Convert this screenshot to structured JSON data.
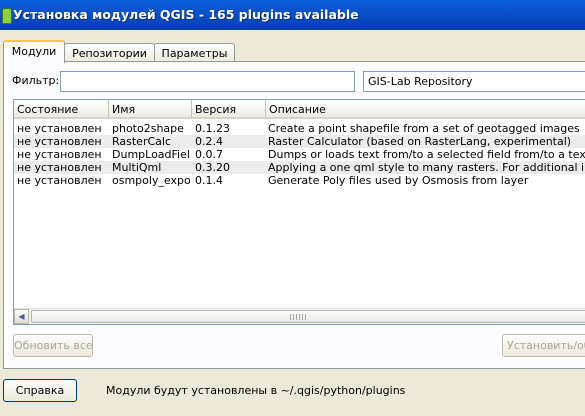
{
  "window": {
    "title": "Установка модулей QGIS - 165 plugins available"
  },
  "tabs": [
    {
      "label": "Модули"
    },
    {
      "label": "Репозитории"
    },
    {
      "label": "Параметры"
    }
  ],
  "filter": {
    "label": "Фильтр:",
    "value": ""
  },
  "repository": {
    "selected": "GIS-Lab Repository"
  },
  "table": {
    "columns": [
      "Состояние",
      "Имя",
      "Версия",
      "Описание"
    ],
    "rows": [
      {
        "status": "не установлен",
        "name": "photo2shape",
        "version": "0.1.23",
        "description": "Create a point shapefile from a set of geotagged images"
      },
      {
        "status": "не установлен",
        "name": "RasterCalc",
        "version": "0.2.4",
        "description": "Raster Calculator (based on RasterLang, experimental)"
      },
      {
        "status": "не установлен",
        "name": "DumpLoadField",
        "version": "0.0.7",
        "description": "Dumps or loads text from/to a selected field from/to a textfile"
      },
      {
        "status": "не установлен",
        "name": "MultiQml",
        "version": "0.3.20",
        "description": "Applying a one qml style to many rasters. For additional info see h"
      },
      {
        "status": "не установлен",
        "name": "osmpoly_export",
        "version": "0.1.4",
        "description": "Generate Poly files used by Osmosis from layer"
      }
    ]
  },
  "buttons": {
    "update_all": "Обновить все",
    "install": "Установить/обн",
    "help": "Справка"
  },
  "status_text": "Модули будут установлены в ~/.qgis/python/plugins"
}
